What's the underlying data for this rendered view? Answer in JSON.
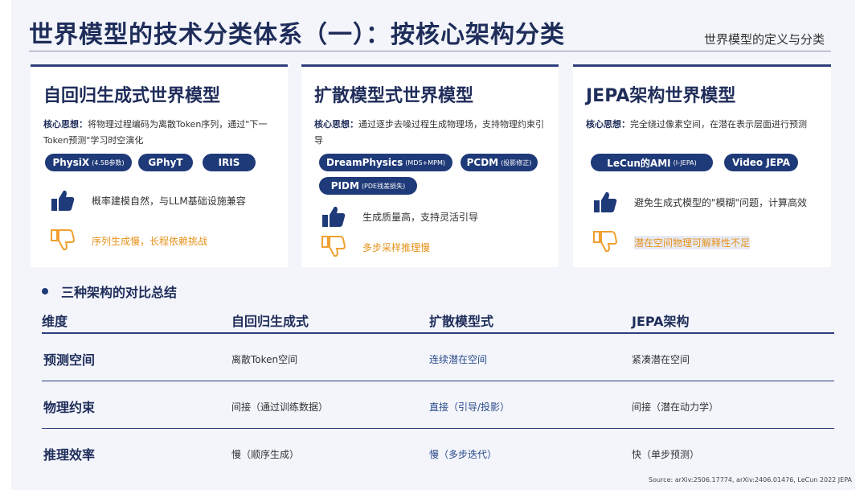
{
  "header": {
    "title": "世界模型的技术分类体系（一）：按核心架构分类",
    "subtitle": "世界模型的定义与分类"
  },
  "cards": [
    {
      "title": "自回归生成式世界模型",
      "desc_label": "核心思想",
      "desc_text": "将物理过程编码为离散Token序列，通过\"下一Token预测\"学习时空演化",
      "tags": [
        {
          "name": "PhysiX",
          "note": "(4.5B参数)"
        },
        {
          "name": "GPhyT",
          "note": ""
        },
        {
          "name": "IRIS",
          "note": ""
        }
      ],
      "pro": "概率建模自然，与LLM基础设施兼容",
      "con": "序列生成慢，长程依赖挑战"
    },
    {
      "title": "扩散模型式世界模型",
      "desc_label": "核心思想",
      "desc_text": "通过逐步去噪过程生成物理场，支持物理约束引导",
      "tags": [
        {
          "name": "DreamPhysics",
          "note": "(MDS+MPM)"
        },
        {
          "name": "PCDM",
          "note": "(投影修正)"
        },
        {
          "name": "PIDM",
          "note": "(PDE残差损失)"
        }
      ],
      "pro": "生成质量高，支持灵活引导",
      "con": "多步采样推理慢"
    },
    {
      "title": "JEPA架构世界模型",
      "desc_label": "核心思想",
      "desc_text": "完全绕过像素空间，在潜在表示层面进行预测",
      "tags": [
        {
          "name": "LeCun的AMI",
          "note": "(I-JEPA)"
        },
        {
          "name": "Video JEPA",
          "note": ""
        }
      ],
      "pro": "避免生成式模型的\"模糊\"问题，计算高效",
      "con": "潜在空间物理可解释性不足"
    }
  ],
  "summary": {
    "heading": "三种架构的对比总结",
    "columns": [
      "维度",
      "自回归生成式",
      "扩散模型式",
      "JEPA架构"
    ],
    "rows": [
      {
        "dim": "预测空间",
        "ar": "离散Token空间",
        "diff": "连续潜在空间",
        "jepa": "紧凑潜在空间"
      },
      {
        "dim": "物理约束",
        "ar": "间接（通过训练数据）",
        "diff": "直接（引导/投影）",
        "jepa": "间接（潜在动力学）"
      },
      {
        "dim": "推理效率",
        "ar": "慢（顺序生成）",
        "diff": "慢（多步迭代）",
        "jepa": "快（单步预测）"
      }
    ]
  },
  "source": "Source: arXiv:2506.17774, arXiv:2406.01476, LeCun 2022 JEPA",
  "colors": {
    "accent": "#1f3a78",
    "title": "#1f2d5a",
    "con": "#e6921a"
  },
  "icons": {
    "pro": "thumbs-up-icon",
    "con": "thumbs-down-icon"
  }
}
